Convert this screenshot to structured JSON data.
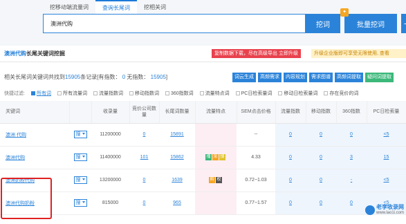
{
  "tabs": [
    "挖移动端流量词",
    "查询长尾词",
    "挖相关词"
  ],
  "search": {
    "value": "澳洲代购",
    "dig_label": "挖词",
    "batch_label": "批量挖词",
    "plus_label": "+"
  },
  "panel": {
    "title_kw": "澳洲代购",
    "title_rest": "长尾关键词挖掘",
    "notice_red": "复制数据下载，尽在高级导出 立即升级",
    "notice_yellow": "升级企业版即可享受无限使用, 查看"
  },
  "summary": {
    "pre": "相关长尾词关键词共找到",
    "count": "15905",
    "mid": "条记录[有指数：",
    "with_index": "0",
    "mid2": "无指数：",
    "no_index": "15905",
    "post": "]"
  },
  "actions": [
    "词云生成",
    "高频需求",
    "内容规划",
    "需求图谱",
    "高频词提取",
    "疑问词提取"
  ],
  "filters": {
    "label": "快捷过滤:",
    "items": [
      "所有词",
      "所有流量词",
      "流量指数词",
      "移动指数词",
      "360指数词",
      "流量特点词",
      "PC日检索量词",
      "移动日检索量词",
      "存在竞价的词"
    ]
  },
  "table": {
    "headers": [
      "关键词",
      "",
      "收录量",
      "竞价公司数量",
      "长尾词数量",
      "流量特点",
      "SEM点击价格",
      "流量指数",
      "移动指数",
      "360指数",
      "PC日检索量"
    ],
    "rows": [
      {
        "keyword": "澳洲 代购",
        "select": "搜",
        "index": "11200000",
        "bid": "0",
        "longtail": "15891",
        "traffic": "",
        "sem": "--",
        "flow": "0",
        "mobile": "0",
        "i360": "0",
        "pc": "<5"
      },
      {
        "keyword": "澳洲代购",
        "select": "搜",
        "index": "11400000",
        "bid": "101",
        "longtail": "15862",
        "traffic": "播 采 搜",
        "sem": "4.33",
        "flow": "0",
        "mobile": "0",
        "i360": "3",
        "pc": "15"
      },
      {
        "keyword": "澳洲奶粉代购",
        "select": "搜",
        "index": "13200000",
        "bid": "0",
        "longtail": "1639",
        "traffic": "购 权",
        "sem": "0.72~1.03",
        "flow": "0",
        "mobile": "0",
        "i360": "-",
        "pc": "<5"
      },
      {
        "keyword": "澳洲代购奶粉",
        "select": "搜",
        "index": "815000",
        "bid": "0",
        "longtail": "965",
        "traffic": "",
        "sem": "0.77~1.57",
        "flow": "0",
        "mobile": "0",
        "i360": "0",
        "pc": "<5"
      }
    ]
  },
  "watermark": {
    "line1": "老李收录网",
    "line2": "www.lao1i.com"
  }
}
